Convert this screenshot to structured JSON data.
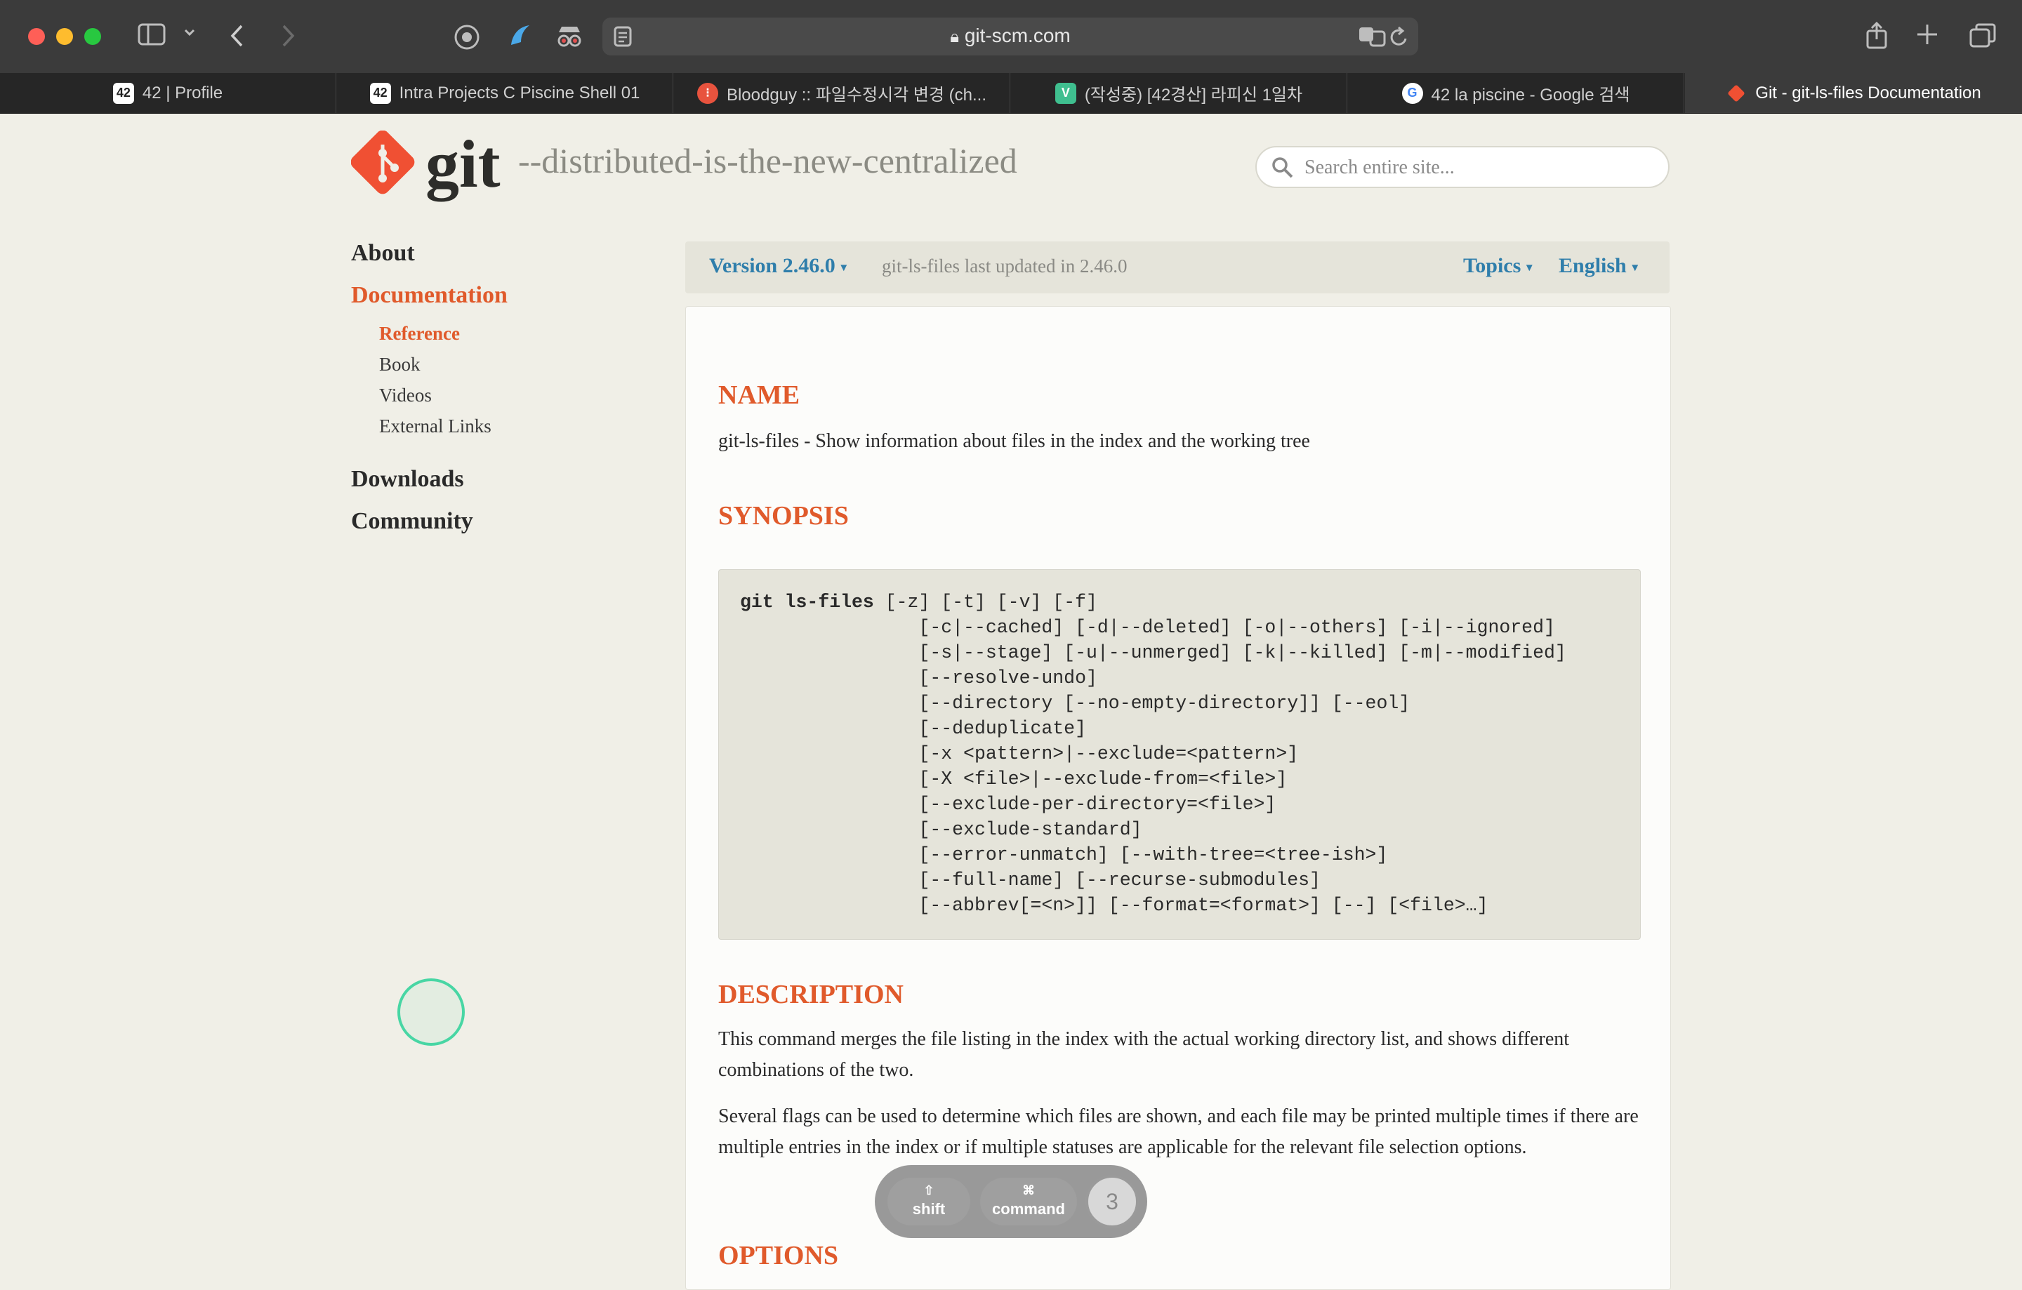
{
  "browser": {
    "url": "git-scm.com",
    "tabs": [
      {
        "title": "42 | Profile",
        "favicon": "42",
        "favicon_color": "#ffffff",
        "favicon_text_color": "#222222"
      },
      {
        "title": "Intra Projects C Piscine Shell 01",
        "favicon": "42",
        "favicon_color": "#ffffff",
        "favicon_text_color": "#222222"
      },
      {
        "title": "Bloodguy :: 파일수정시각 변경 (ch...",
        "favicon": "⁝",
        "favicon_color": "#e8533e",
        "favicon_text_color": "#ffffff"
      },
      {
        "title": "(작성중) [42경산] 라피신 1일차",
        "favicon": "V",
        "favicon_color": "#3fbf8f",
        "favicon_text_color": "#ffffff"
      },
      {
        "title": "42 la piscine - Google 검색",
        "favicon": "G",
        "favicon_color": "#ffffff",
        "favicon_text_color": "#4285f4"
      },
      {
        "title": "Git - git-ls-files Documentation",
        "favicon": "◆",
        "favicon_color": "#f05033",
        "favicon_text_color": "#ffffff"
      }
    ],
    "active_tab": 5
  },
  "site": {
    "logo_text": "git",
    "tagline": "--distributed-is-the-new-centralized",
    "search_placeholder": "Search entire site...",
    "brand_color": "#f05033"
  },
  "sidebar": {
    "about": "About",
    "documentation": "Documentation",
    "reference": "Reference",
    "book": "Book",
    "videos": "Videos",
    "external_links": "External Links",
    "downloads": "Downloads",
    "community": "Community"
  },
  "version_bar": {
    "version": "Version 2.46.0",
    "note": "git-ls-files last updated in 2.46.0",
    "topics": "Topics",
    "language": "English"
  },
  "doc": {
    "name_heading": "NAME",
    "name_text": "git-ls-files - Show information about files in the index and the working tree",
    "synopsis_heading": "SYNOPSIS",
    "synopsis_command": "git ls-files",
    "synopsis_lines": [
      " [-z] [-t] [-v] [-f]",
      "                [-c|--cached] [-d|--deleted] [-o|--others] [-i|--ignored]",
      "                [-s|--stage] [-u|--unmerged] [-k|--killed] [-m|--modified]",
      "                [--resolve-undo]",
      "                [--directory [--no-empty-directory]] [--eol]",
      "                [--deduplicate]",
      "                [-x <pattern>|--exclude=<pattern>]",
      "                [-X <file>|--exclude-from=<file>]",
      "                [--exclude-per-directory=<file>]",
      "                [--exclude-standard]",
      "                [--error-unmatch] [--with-tree=<tree-ish>]",
      "                [--full-name] [--recurse-submodules]",
      "                [--abbrev[=<n>]] [--format=<format>] [--] [<file>…]"
    ],
    "description_heading": "DESCRIPTION",
    "description_p1": "This command merges the file listing in the index with the actual working directory list, and shows different combinations of the two.",
    "description_p2": "Several flags can be used to determine which files are shown, and each file may be printed multiple times if there are multiple entries in the index or if multiple statuses are applicable for the relevant file selection options.",
    "options_heading": "OPTIONS"
  },
  "keycast": {
    "keys": [
      {
        "symbol": "⇧",
        "label": "shift"
      },
      {
        "symbol": "⌘",
        "label": "command"
      }
    ],
    "count": "3"
  }
}
